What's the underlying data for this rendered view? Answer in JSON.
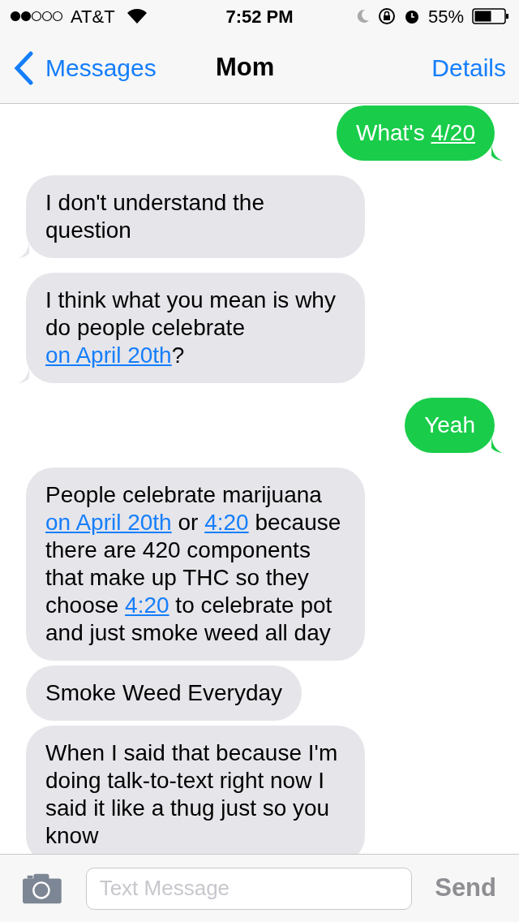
{
  "status_bar": {
    "carrier": "AT&T",
    "time": "7:52 PM",
    "battery": "55%"
  },
  "nav": {
    "back": "Messages",
    "title": "Mom",
    "action": "Details"
  },
  "messages": [
    {
      "kind": "sent",
      "tail": true,
      "parts": [
        {
          "text": "What's "
        },
        {
          "text": "4/20",
          "link": true
        }
      ]
    },
    {
      "kind": "received",
      "tail": true,
      "parts": [
        {
          "text": "I don't understand the question"
        }
      ]
    },
    {
      "kind": "received",
      "tail": true,
      "parts": [
        {
          "text": "I think what you mean is why do people celebrate "
        },
        {
          "text": "on April 20th",
          "link": true
        },
        {
          "text": "?"
        }
      ]
    },
    {
      "kind": "sent",
      "tail": true,
      "parts": [
        {
          "text": "Yeah"
        }
      ]
    },
    {
      "kind": "received",
      "tail": false,
      "parts": [
        {
          "text": "People celebrate marijuana "
        },
        {
          "text": "on April 20th",
          "link": true
        },
        {
          "text": " or "
        },
        {
          "text": "4:20",
          "link": true
        },
        {
          "text": " because there are 420 components that make up THC so they choose "
        },
        {
          "text": "4:20",
          "link": true
        },
        {
          "text": " to celebrate pot and just smoke weed all day"
        }
      ]
    },
    {
      "kind": "received",
      "tail": false,
      "parts": [
        {
          "text": "Smoke Weed Everyday"
        }
      ]
    },
    {
      "kind": "received",
      "tail": false,
      "parts": [
        {
          "text": "When I said that because I'm doing talk-to-text right now I said it like a thug just so you know"
        }
      ]
    }
  ],
  "composer": {
    "placeholder": "Text Message",
    "send": "Send"
  }
}
